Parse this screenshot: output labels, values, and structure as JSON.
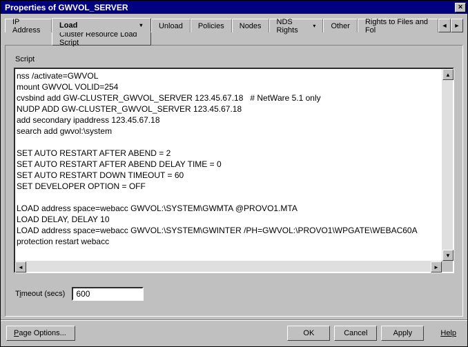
{
  "window": {
    "title": "Properties of GWVOL_SERVER"
  },
  "tabs": {
    "ip": "IP Address",
    "load": "Load",
    "load_sub": "Cluster Resource Load Script",
    "unload": "Unload",
    "policies": "Policies",
    "nodes": "Nodes",
    "nds": "NDS Rights",
    "other": "Other",
    "rights": "Rights to Files and Fol"
  },
  "script": {
    "label": "Script",
    "text": "nss /activate=GWVOL\nmount GWVOL VOLID=254\ncvsbind add GW-CLUSTER_GWVOL_SERVER 123.45.67.18   # NetWare 5.1 only\nNUDP ADD GW-CLUSTER_GWVOL_SERVER 123.45.67.18\nadd secondary ipaddress 123.45.67.18\nsearch add gwvol:\\system\n\nSET AUTO RESTART AFTER ABEND = 2\nSET AUTO RESTART AFTER ABEND DELAY TIME = 0\nSET AUTO RESTART DOWN TIMEOUT = 60\nSET DEVELOPER OPTION = OFF\n\nLOAD address space=webacc GWVOL:\\SYSTEM\\GWMTA @PROVO1.MTA\nLOAD DELAY, DELAY 10\nLOAD address space=webacc GWVOL:\\SYSTEM\\GWINTER /PH=GWVOL:\\PROVO1\\WPGATE\\WEBAC60A\nprotection restart webacc"
  },
  "timeout": {
    "label_pre": "T",
    "label_u": "i",
    "label_post": "meout (secs)",
    "value": "600"
  },
  "footer": {
    "page_options_pre": "",
    "page_options_u": "P",
    "page_options_post": "age Options...",
    "ok": "OK",
    "cancel": "Cancel",
    "apply": "Apply",
    "help_u": "H",
    "help_post": "elp"
  }
}
